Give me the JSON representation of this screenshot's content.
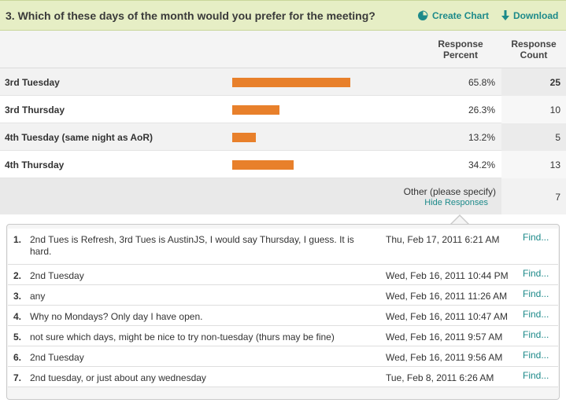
{
  "question": {
    "title": "3. Which of these days of the month would you prefer for the meeting?",
    "create_chart_label": "Create Chart",
    "download_label": "Download",
    "accent_color": "#1d8a8a"
  },
  "columns": {
    "percent_label_line1": "Response",
    "percent_label_line2": "Percent",
    "count_label_line1": "Response",
    "count_label_line2": "Count"
  },
  "answers": [
    {
      "label": "3rd Tuesday",
      "percent": "65.8%",
      "fraction": 0.658,
      "count": "25"
    },
    {
      "label": "3rd Thursday",
      "percent": "26.3%",
      "fraction": 0.263,
      "count": "10"
    },
    {
      "label": "4th Tuesday (same night as AoR)",
      "percent": "13.2%",
      "fraction": 0.132,
      "count": "5"
    },
    {
      "label": "4th Thursday",
      "percent": "34.2%",
      "fraction": 0.342,
      "count": "13"
    }
  ],
  "bar_color": "#e8802b",
  "other": {
    "label": "Other (please specify)",
    "hide_label": "Hide Responses",
    "count": "7"
  },
  "responses": [
    {
      "num": "1.",
      "text": "2nd Tues is Refresh, 3rd Tues is AustinJS, I would say Thursday, I guess. It is hard.",
      "date": "Thu, Feb 17, 2011 6:21 AM",
      "find": "Find..."
    },
    {
      "num": "2.",
      "text": "2nd Tuesday",
      "date": "Wed, Feb 16, 2011 10:44 PM",
      "find": "Find..."
    },
    {
      "num": "3.",
      "text": "any",
      "date": "Wed, Feb 16, 2011 11:26 AM",
      "find": "Find..."
    },
    {
      "num": "4.",
      "text": "Why no Mondays? Only day I have open.",
      "date": "Wed, Feb 16, 2011 10:47 AM",
      "find": "Find..."
    },
    {
      "num": "5.",
      "text": "not sure which days, might be nice to try non-tuesday (thurs may be fine)",
      "date": "Wed, Feb 16, 2011 9:57 AM",
      "find": "Find..."
    },
    {
      "num": "6.",
      "text": "2nd Tuesday",
      "date": "Wed, Feb 16, 2011 9:56 AM",
      "find": "Find..."
    },
    {
      "num": "7.",
      "text": "2nd tuesday, or just about any wednesday",
      "date": "Tue, Feb 8, 2011 6:26 AM",
      "find": "Find..."
    }
  ]
}
